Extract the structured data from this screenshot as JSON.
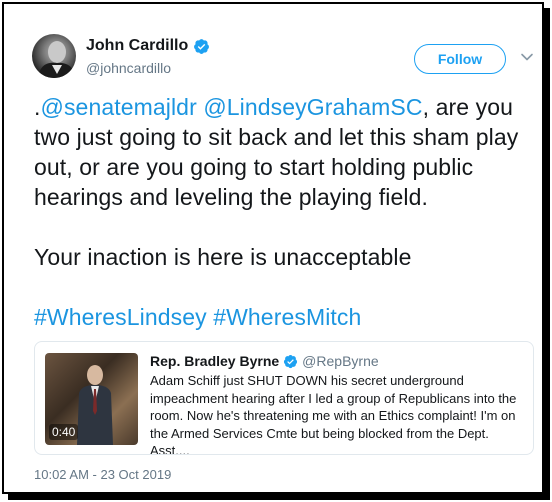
{
  "author": {
    "name": "John Cardillo",
    "handle": "@johncardillo",
    "verified": true
  },
  "follow_button": {
    "label": "Follow"
  },
  "tweet": {
    "mention_1_prefix": ".",
    "mention_1": "@senatemajldr",
    "mention_2": "@LindseyGrahamSC",
    "line_1_rest": ", are you two just going to sit back and let this sham play out, or are you going to start holding public hearings and leveling the playing field.",
    "paragraph_2": "Your inaction is here is unacceptable",
    "hashtag_1": "#WheresLindsey",
    "hashtag_2": "#WheresMitch"
  },
  "quoted_tweet": {
    "name": "Rep. Bradley Byrne",
    "handle": "@RepByrne",
    "verified": true,
    "video_duration": "0:40",
    "text": "Adam Schiff just SHUT DOWN his secret underground impeachment hearing after I led a group of Republicans into the room. Now he's threatening me with an Ethics complaint! I'm on the Armed Services Cmte but being blocked from the Dept. Asst...."
  },
  "timestamp": "10:02 AM - 23 Oct 2019",
  "colors": {
    "link": "#1b95e0",
    "verified": "#1da1f2",
    "secondary_text": "#657786"
  }
}
